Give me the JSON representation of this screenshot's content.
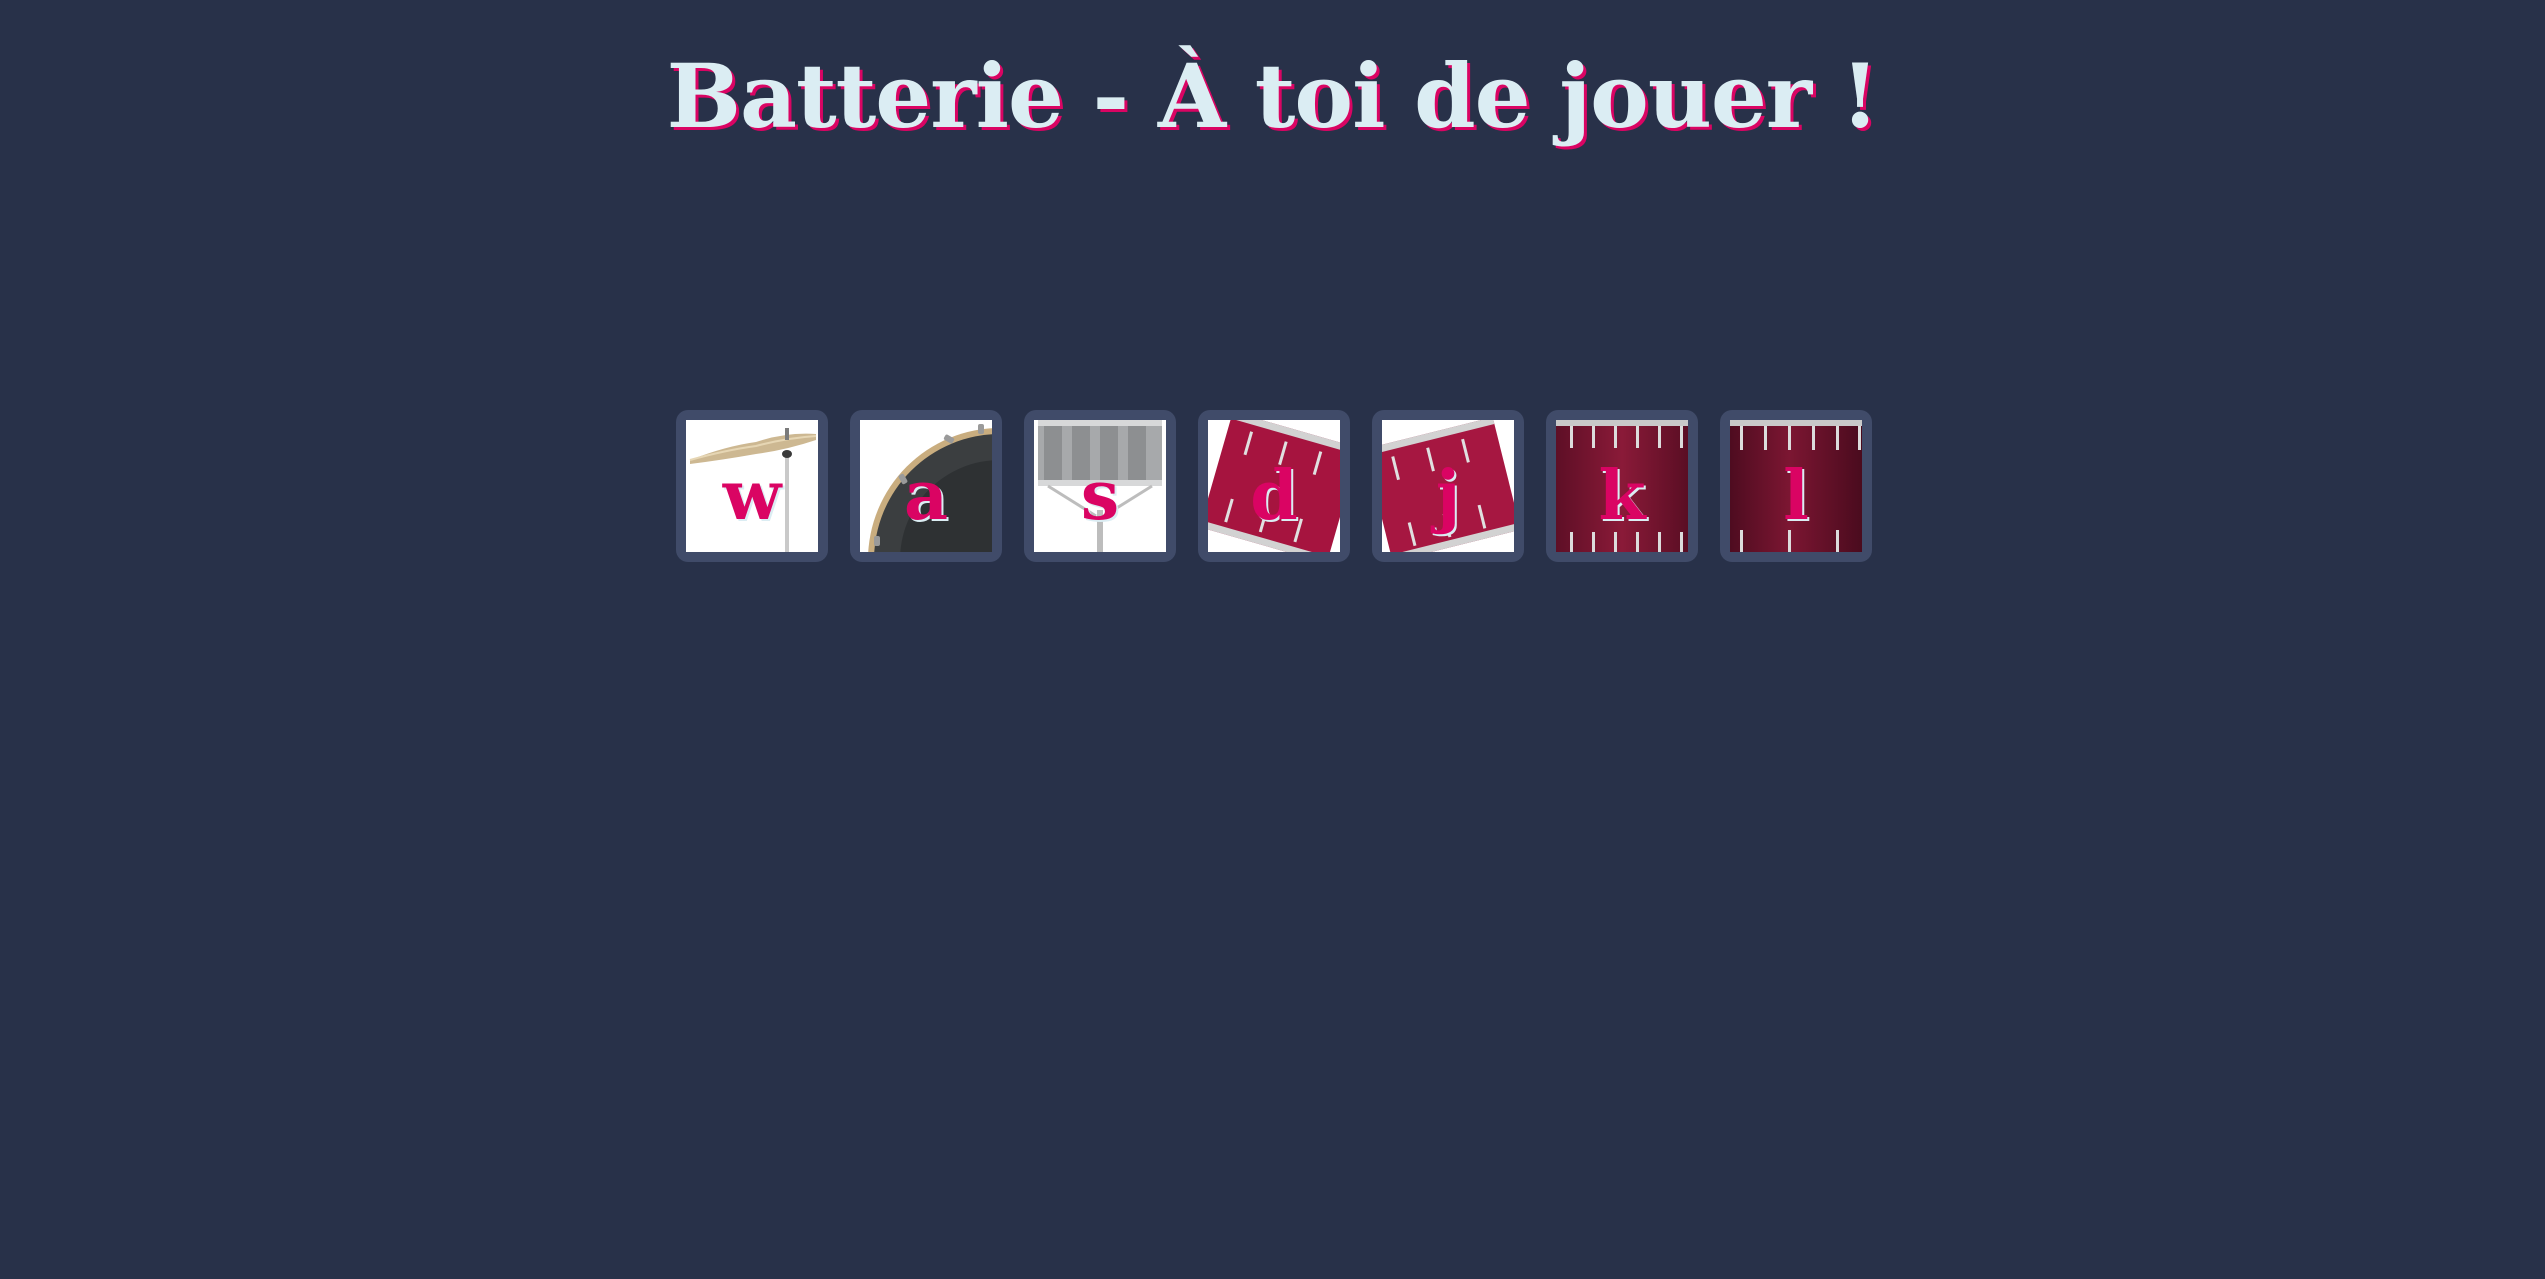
{
  "page": {
    "title": "Batterie - À toi de jouer !"
  },
  "colors": {
    "background": "#283149",
    "tile_frame": "#404b69",
    "title_text": "#dbedf3",
    "accent": "#da0463"
  },
  "drums": [
    {
      "key": "w",
      "icon": "crash-cymbal-icon"
    },
    {
      "key": "a",
      "icon": "kick-drum-icon"
    },
    {
      "key": "s",
      "icon": "snare-drum-icon"
    },
    {
      "key": "d",
      "icon": "tom-1-icon"
    },
    {
      "key": "j",
      "icon": "tom-2-icon"
    },
    {
      "key": "k",
      "icon": "tom-3-icon"
    },
    {
      "key": "l",
      "icon": "floor-tom-icon"
    }
  ]
}
